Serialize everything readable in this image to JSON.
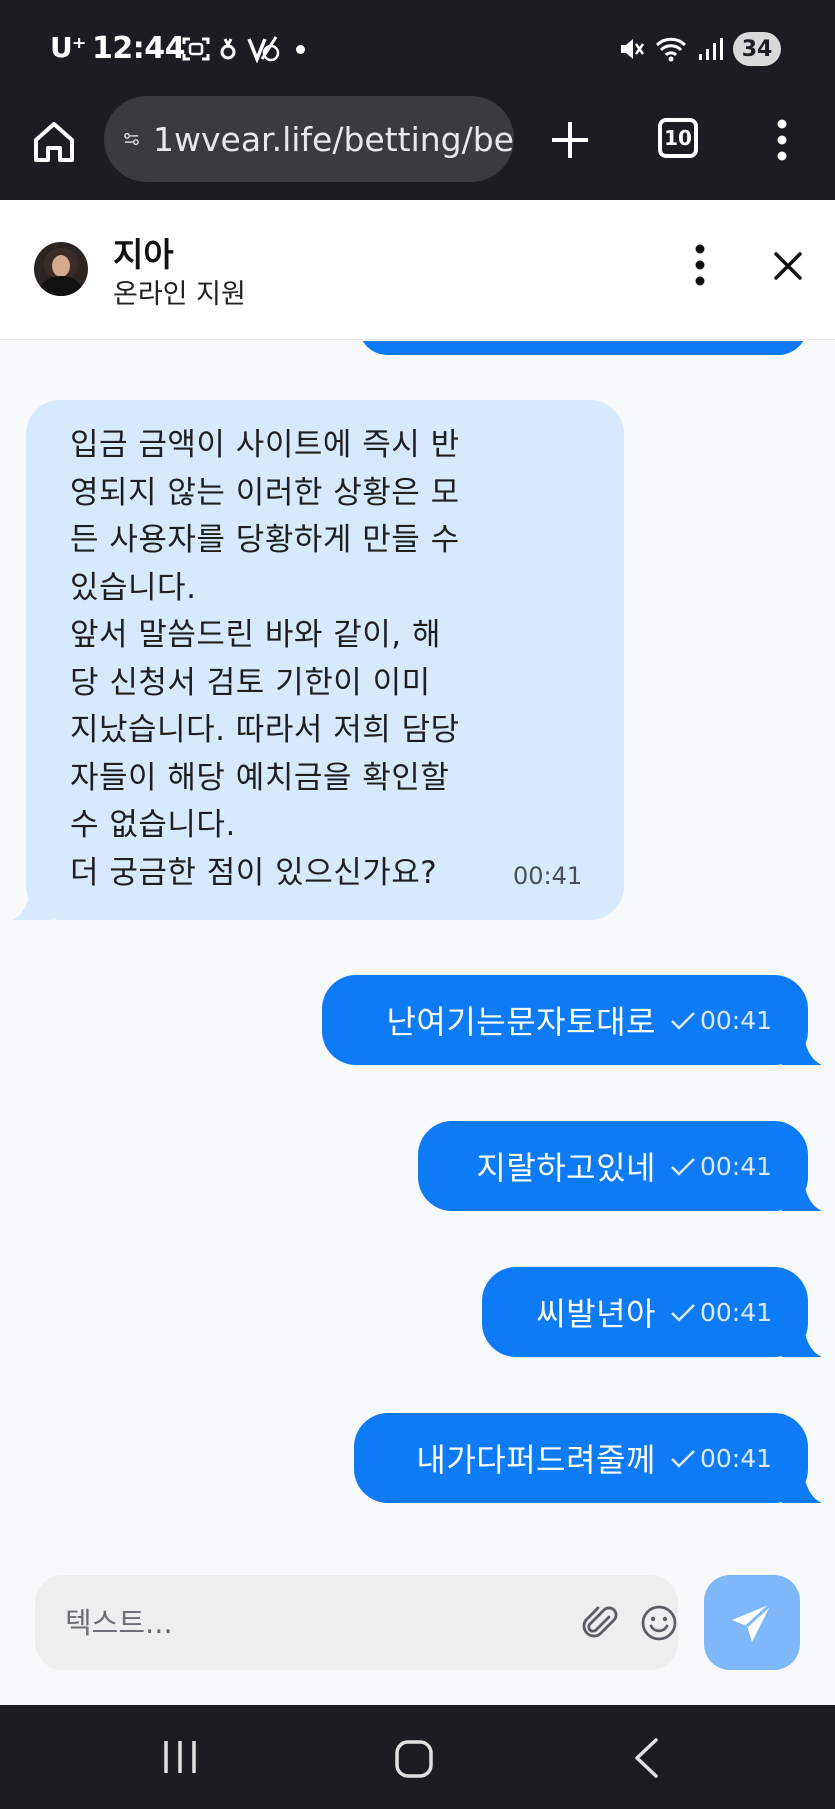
{
  "status_bar": {
    "carrier": "U⁺",
    "time": "12:44",
    "battery": "34",
    "icons_left": [
      "screenshot-icon",
      "location-icon",
      "data-saver-icon",
      "notification-dot"
    ],
    "icons_right": [
      "mute-icon",
      "wifi-icon",
      "signal-icon"
    ]
  },
  "browser": {
    "url": "1wvear.life/betting/be",
    "tab_count": "10"
  },
  "chat": {
    "agent_name": "지아",
    "agent_status": "온라인 지원"
  },
  "messages": [
    {
      "direction": "incoming",
      "text": "입금 금액이 사이트에 즉시 반\n영되지 않는 이러한 상황은 모\n든 사용자를 당황하게 만들 수\n있습니다.\n앞서 말씀드린 바와 같이, 해\n당 신청서 검토 기한이 이미\n지났습니다. 따라서 저희 담당\n자들이 해당 예치금을 확인할\n수 없습니다.\n더 궁금한 점이 있으신가요?",
      "time": "00:41"
    },
    {
      "direction": "outgoing",
      "text": "난여기는문자토대로",
      "time": "00:41",
      "status": "sent"
    },
    {
      "direction": "outgoing",
      "text": "지랄하고있네",
      "time": "00:41",
      "status": "sent"
    },
    {
      "direction": "outgoing",
      "text": "씨발년아",
      "time": "00:41",
      "status": "sent"
    },
    {
      "direction": "outgoing",
      "text": "내가다퍼드려줄께",
      "time": "00:41",
      "status": "sent"
    }
  ],
  "composer": {
    "placeholder": "텍스트..."
  },
  "colors": {
    "outgoing_bubble": "#0e7bf6",
    "incoming_bubble": "#d6e9fd",
    "send_button": "#7eb8fb",
    "system_bar": "#1c1d22"
  }
}
